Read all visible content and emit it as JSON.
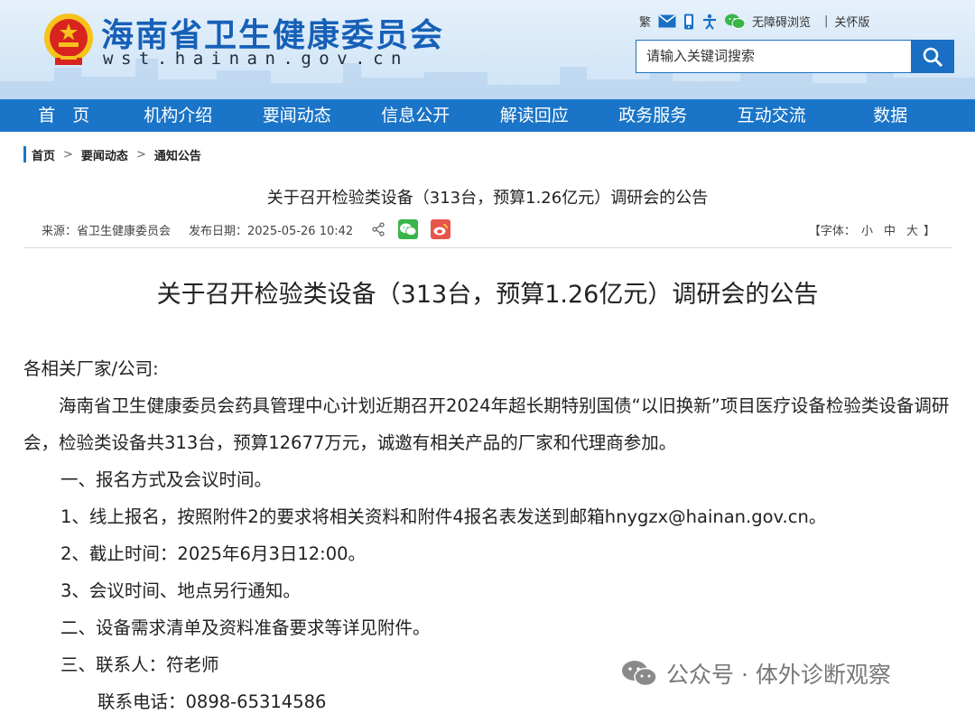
{
  "header": {
    "title": "海南省卫生健康委员会",
    "domain": "wst.hainan.gov.cn",
    "top_links": {
      "traditional": "繁",
      "accessible": "无障碍浏览",
      "elder_mode": "关怀版"
    },
    "search": {
      "placeholder": "请输入关键词搜索"
    }
  },
  "nav": {
    "items": [
      "首　页",
      "机构介绍",
      "要闻动态",
      "信息公开",
      "解读回应",
      "政务服务",
      "互动交流",
      "数据"
    ]
  },
  "breadcrumb": {
    "home": "首页",
    "section": "要闻动态",
    "current": "通知公告",
    "arrow": ">"
  },
  "article": {
    "head_title": "关于召开检验类设备（313台，预算1.26亿元）调研会的公告",
    "source": "来源：省卫生健康委员会",
    "date": "发布日期：2025-05-26 10:42",
    "font_label": "【字体：",
    "font_small": "小",
    "font_medium": "中",
    "font_large": "大",
    "font_close": "】",
    "main_title": "关于召开检验类设备（313台，预算1.26亿元）调研会的公告",
    "greeting": "各相关厂家/公司:",
    "intro": "海南省卫生健康委员会药具管理中心计划近期召开2024年超长期特别国债“以旧换新”项目医疗设备检验类设备调研会，检验类设备共313台，预算12677万元，诚邀有相关产品的厂家和代理商参加。",
    "s1": "一、报名方式及会议时间。",
    "s1_1": "1、线上报名，按照附件2的要求将相关资料和附件4报名表发送到邮箱hnygzx@hainan.gov.cn。",
    "s1_2": "2、截止时间：2025年6月3日12:00。",
    "s1_3": "3、会议时间、地点另行通知。",
    "s2": "二、设备需求清单及资料准备要求等详见附件。",
    "s3": "三、联系人：符老师",
    "phone": "联系电话：0898-65314586"
  },
  "watermark": {
    "text": "公众号 · 体外诊断观察"
  },
  "colors": {
    "brand_blue": "#1a74c7",
    "title_blue": "#1660b7",
    "wechat_green": "#39b54a",
    "weibo_red": "#e6554a"
  }
}
